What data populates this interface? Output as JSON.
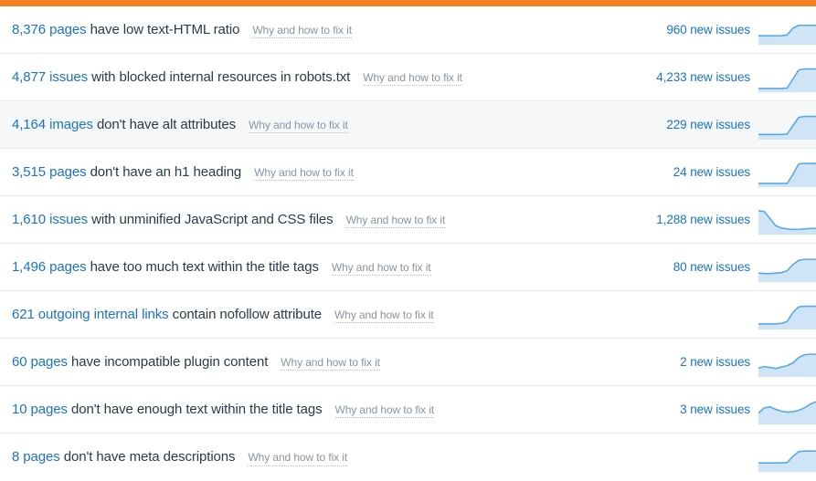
{
  "theme": {
    "accent_bar_color": "#f58220",
    "link_color": "#1a73c8",
    "text_color": "#2a3a47",
    "muted_link_color": "#8794a0",
    "row_divider_color": "#e3ebf2",
    "striped_row_color": "#f6f7f8",
    "sparkline_stroke": "#5aa9e6",
    "sparkline_fill": "#cfe5f7"
  },
  "fix_link_label": "Why and how to fix it",
  "new_issues_suffix": "new issues",
  "rows": [
    {
      "count": "8,376 pages",
      "description": "have low text-HTML ratio",
      "fix_link": "Why and how to fix it",
      "new_issues": "960 new issues",
      "striped": false,
      "sparkline": {
        "type": "area",
        "values": [
          30,
          30,
          30,
          30,
          30,
          34,
          62,
          74,
          74,
          74,
          74
        ]
      }
    },
    {
      "count": "4,877 issues",
      "description": "with blocked internal resources in robots.txt",
      "fix_link": "Why and how to fix it",
      "new_issues": "4,233 new issues",
      "striped": false,
      "sparkline": {
        "type": "area",
        "values": [
          8,
          8,
          8,
          8,
          8,
          10,
          48,
          86,
          90,
          90,
          90
        ]
      }
    },
    {
      "count": "4,164 images",
      "description": "don't have alt attributes",
      "fix_link": "Why and how to fix it",
      "new_issues": "229 new issues",
      "striped": true,
      "sparkline": {
        "type": "area",
        "values": [
          14,
          14,
          14,
          14,
          14,
          16,
          52,
          86,
          90,
          90,
          90
        ]
      }
    },
    {
      "count": "3,515 pages",
      "description": "don't have an h1 heading",
      "fix_link": "Why and how to fix it",
      "new_issues": "24 new issues",
      "striped": false,
      "sparkline": {
        "type": "area",
        "values": [
          8,
          8,
          8,
          8,
          8,
          8,
          46,
          90,
          92,
          92,
          92
        ]
      }
    },
    {
      "count": "1,610 issues",
      "description": "with unminified JavaScript and CSS files",
      "fix_link": "Why and how to fix it",
      "new_issues": "1,288 new issues",
      "striped": false,
      "sparkline": {
        "type": "area",
        "values": [
          92,
          90,
          60,
          30,
          20,
          16,
          14,
          14,
          16,
          18,
          18
        ]
      }
    },
    {
      "count": "1,496 pages",
      "description": "have too much text within the title tags",
      "fix_link": "Why and how to fix it",
      "new_issues": "80 new issues",
      "striped": false,
      "sparkline": {
        "type": "area",
        "values": [
          30,
          28,
          28,
          30,
          32,
          40,
          66,
          84,
          88,
          88,
          88
        ]
      }
    },
    {
      "count": "621 outgoing internal links",
      "description": "contain nofollow attribute",
      "fix_link": "Why and how to fix it",
      "new_issues": "",
      "striped": false,
      "sparkline": {
        "type": "area",
        "values": [
          16,
          16,
          16,
          16,
          18,
          26,
          64,
          88,
          90,
          90,
          90
        ]
      }
    },
    {
      "count": "60 pages",
      "description": "have incompatible plugin content",
      "fix_link": "Why and how to fix it",
      "new_issues": "2 new issues",
      "striped": false,
      "sparkline": {
        "type": "area",
        "values": [
          30,
          36,
          32,
          28,
          34,
          40,
          52,
          74,
          86,
          88,
          88
        ]
      }
    },
    {
      "count": "10 pages",
      "description": "don't have enough text within the title tags",
      "fix_link": "Why and how to fix it",
      "new_issues": "3 new issues",
      "striped": false,
      "sparkline": {
        "type": "area",
        "values": [
          40,
          62,
          66,
          56,
          48,
          44,
          46,
          52,
          62,
          78,
          88
        ]
      }
    },
    {
      "count": "8 pages",
      "description": "don't have meta descriptions",
      "fix_link": "Why and how to fix it",
      "new_issues": "",
      "striped": false,
      "sparkline": {
        "type": "area",
        "values": [
          30,
          30,
          30,
          30,
          30,
          32,
          58,
          78,
          80,
          80,
          80
        ]
      }
    }
  ]
}
